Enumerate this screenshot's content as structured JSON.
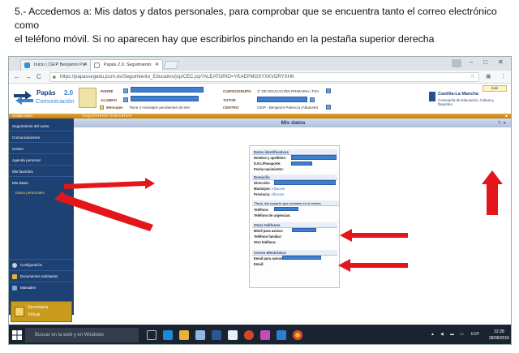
{
  "instructions": {
    "line1": "5.- Accedemos a: Mis datos y datos personales, para comprobar que se encuentra tanto el correo electrónico como",
    "line2": "el teléfono móvil. Si no aparecen hay que escribirlos pinchando en la pestaña superior derecha"
  },
  "browser": {
    "tabs": [
      {
        "label": "Inicio | CEIP Benjamin Pa"
      },
      {
        "label": "Papás 2.0. Seguimiento"
      }
    ],
    "url": "https://papassegedu.jccm.es/Seguimiento_Educativo/jsp/CEC.jsp?ALEATORIO=YKAEPMGSYXKVDRYXHK"
  },
  "header": {
    "app_name_1": "Papás",
    "app_name_2": "2.0",
    "app_sub": "Comunicación",
    "padre_label": "PADRE",
    "alumno_label": "ALUMNO",
    "mensajes_label": "Mensajes",
    "mensajes_value": "Tiene 4 mensajes pendientes de leer",
    "curso_label": "CURSO/GRUPO",
    "curso_value": "1º DE EDUCACIÓN PRIMARIA / P3A",
    "tutor_label": "TUTOR",
    "centro_label": "CENTRO",
    "centro_value": "CEIP - Benjamín Palencia (Albacete)",
    "jccm_1": "Castilla-La Mancha",
    "jccm_2": "Consejería de Educación, Cultura y Deportes",
    "salir": "Salir"
  },
  "overbar": {
    "ocultar": "ocultar menú",
    "title": "Seguimiento Educativo"
  },
  "sidebar": {
    "items": [
      {
        "label": "Seguimiento del curso"
      },
      {
        "label": "Comunicaciones"
      },
      {
        "label": "Centro"
      },
      {
        "label": "Agenda personal"
      },
      {
        "label": "Mis favoritos"
      },
      {
        "label": "Mis datos"
      },
      {
        "label": "Datos personales"
      }
    ],
    "bottom": [
      {
        "label": "Configuración"
      },
      {
        "label": "Documentos solicitados"
      },
      {
        "label": "Manuales"
      }
    ],
    "secretaria_1": "Secretaría",
    "secretaria_2": "Virtual"
  },
  "main": {
    "title": "Mis datos",
    "sections": {
      "identificativos": "Datos identificativos",
      "domicilio": "Domicilio",
      "telefonos": "Tfnos. del usuario que constan en el centro",
      "otros": "Otros teléfonos",
      "correo": "Correo Electrónico"
    },
    "fields": {
      "nombre": "Nombre y apellidos:",
      "dni": "D.N.I./Pasaporte:",
      "fecha": "Fecha nacimiento:",
      "direccion": "Dirección:",
      "municipio": "Municipio:",
      "municipio_val": "Albacete",
      "provincia": "Provincia:",
      "provincia_val": "Albacete",
      "telefono": "Teléfono:",
      "urgencias": "Teléfono de urgencias:",
      "movil": "Móvil para avisos:",
      "familiar": "Teléfono familiar:",
      "otro": "Otro teléfono:",
      "email_avisos": "Email para avisos:",
      "email": "Email:"
    }
  },
  "taskbar": {
    "search": "Buscar en la web y en Windows",
    "lang": "ESP",
    "time": "22:28",
    "date": "28/06/2016"
  }
}
